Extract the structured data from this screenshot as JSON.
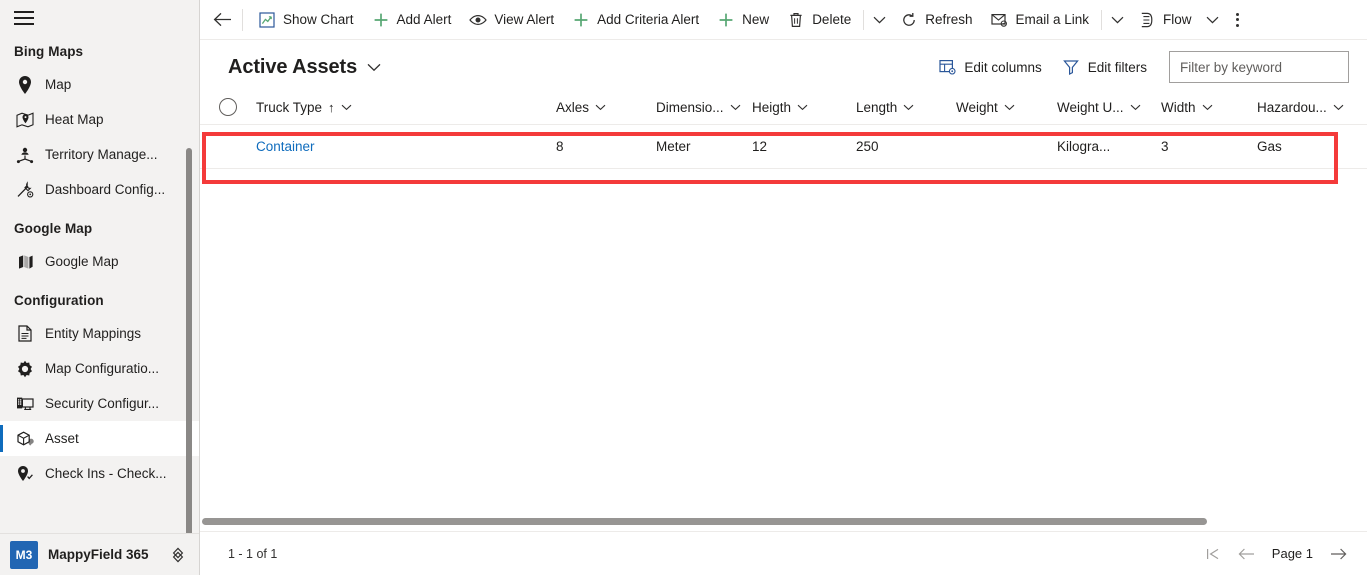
{
  "sidebar": {
    "hamburger": "hamburger-menu",
    "groups": [
      {
        "title": "Bing Maps",
        "items": [
          {
            "label": "Map",
            "icon": "map-pin-icon"
          },
          {
            "label": "Heat Map",
            "icon": "heat-map-icon"
          },
          {
            "label": "Territory Manage...",
            "icon": "territory-management-icon"
          },
          {
            "label": "Dashboard Config...",
            "icon": "dashboard-config-icon"
          }
        ]
      },
      {
        "title": "Google Map",
        "items": [
          {
            "label": "Google Map",
            "icon": "folded-map-icon"
          }
        ]
      },
      {
        "title": "Configuration",
        "items": [
          {
            "label": "Entity Mappings",
            "icon": "document-icon"
          },
          {
            "label": "Map Configuratio...",
            "icon": "gear-icon"
          },
          {
            "label": "Security Configur...",
            "icon": "security-icon"
          },
          {
            "label": "Asset",
            "icon": "asset-box-icon",
            "selected": true
          },
          {
            "label": "Check Ins - Check...",
            "icon": "check-in-pin-icon"
          }
        ]
      }
    ],
    "footer": {
      "badge": "M3",
      "app_name": "MappyField 365",
      "switcher_icon": "app-switcher-icon"
    }
  },
  "commandbar": {
    "back_icon": "back-arrow-icon",
    "buttons": [
      {
        "label": "Show Chart",
        "icon": "show-chart-icon"
      },
      {
        "label": "Add Alert",
        "icon": "plus-icon"
      },
      {
        "label": "View Alert",
        "icon": "eye-icon"
      },
      {
        "label": "Add Criteria Alert",
        "icon": "plus-icon"
      },
      {
        "label": "New",
        "icon": "plus-icon"
      },
      {
        "label": "Delete",
        "icon": "trash-icon"
      },
      {
        "label": "Refresh",
        "icon": "refresh-icon"
      },
      {
        "label": "Email a Link",
        "icon": "email-link-icon"
      },
      {
        "label": "Flow",
        "icon": "flow-icon"
      }
    ],
    "overflow_icon": "more-options-icon"
  },
  "view": {
    "title": "Active Assets",
    "title_chevron": "chevron-down-icon",
    "edit_columns": {
      "label": "Edit columns",
      "icon": "edit-columns-icon"
    },
    "edit_filters": {
      "label": "Edit filters",
      "icon": "filter-icon"
    },
    "search": {
      "placeholder": "Filter by keyword",
      "value": ""
    }
  },
  "grid": {
    "select_all_icon": "select-all-circle-icon",
    "columns": [
      {
        "label": "Truck Type",
        "sorted": "ascending",
        "sort_glyph": "↑"
      },
      {
        "label": "Axles"
      },
      {
        "label": "Dimensio..."
      },
      {
        "label": "Heigth"
      },
      {
        "label": "Length"
      },
      {
        "label": "Weight"
      },
      {
        "label": "Weight U..."
      },
      {
        "label": "Width"
      },
      {
        "label": "Hazardou..."
      }
    ],
    "rows": [
      {
        "truck_type": "Container",
        "axles": "8",
        "dimension": "Meter",
        "heigth": "12",
        "length": "250",
        "weight": "",
        "weight_unit": "Kilogra...",
        "width": "3",
        "hazardous": "Gas"
      }
    ],
    "highlight_color": "#f43a3a"
  },
  "footer": {
    "record_count": "1 - 1 of 1",
    "pager": {
      "first_icon": "first-page-icon",
      "prev_icon": "previous-page-icon",
      "page_label": "Page 1",
      "next_icon": "next-page-icon"
    }
  }
}
